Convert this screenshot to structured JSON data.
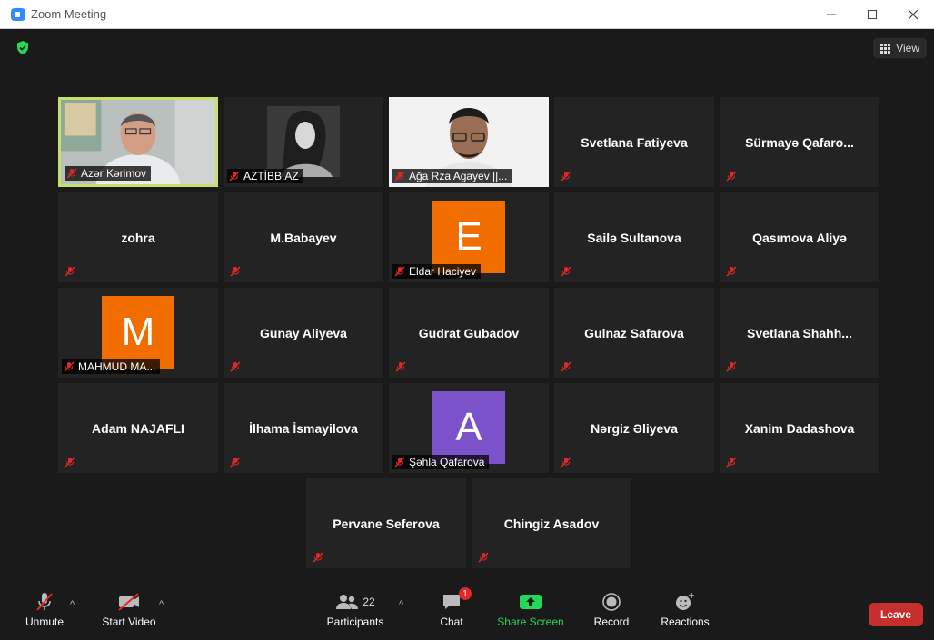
{
  "window": {
    "title": "Zoom Meeting"
  },
  "view": {
    "label": "View"
  },
  "participants": [
    {
      "name": "Azər Kərimov",
      "label": true,
      "video": true,
      "active": true
    },
    {
      "name": "AZTİBB.AZ",
      "label": true,
      "video": true
    },
    {
      "name": "Ağa Rza Agayev ||...",
      "label": true,
      "video": true
    },
    {
      "name": "Svetlana Fatiyeva"
    },
    {
      "name": "Sürmayə  Qafaro..."
    },
    {
      "name": "zohra"
    },
    {
      "name": "M.Babayev"
    },
    {
      "name": "Eldar Haciyev",
      "label": true,
      "avatar_letter": "E",
      "avatar_color": "#f26d00"
    },
    {
      "name": "Sailə Sultanova"
    },
    {
      "name": "Qasımova Aliyə"
    },
    {
      "name": "MAHMUD MA...",
      "label": true,
      "avatar_letter": "M",
      "avatar_color": "#f26d00"
    },
    {
      "name": "Gunay Aliyeva"
    },
    {
      "name": "Gudrat Gubadov"
    },
    {
      "name": "Gulnaz Safarova"
    },
    {
      "name": "Svetlana  Shahh..."
    },
    {
      "name": "Adam NAJAFLI"
    },
    {
      "name": "İlhama İsmayilova"
    },
    {
      "name": "Şəhla Qafarova",
      "label": true,
      "avatar_letter": "A",
      "avatar_color": "#7b52c9"
    },
    {
      "name": "Nərgiz Əliyeva"
    },
    {
      "name": "Xanim Dadashova"
    },
    {
      "name": "Pervane Seferova"
    },
    {
      "name": "Chingiz Asadov"
    }
  ],
  "toolbar": {
    "unmute": "Unmute",
    "start_video": "Start Video",
    "participants": "Participants",
    "participant_count": "22",
    "chat": "Chat",
    "chat_badge": "1",
    "share_screen": "Share Screen",
    "record": "Record",
    "reactions": "Reactions",
    "leave": "Leave"
  },
  "colors": {
    "share_green": "#23d959",
    "leave_red": "#c5302c",
    "active_speaker": "#c6e06a"
  }
}
